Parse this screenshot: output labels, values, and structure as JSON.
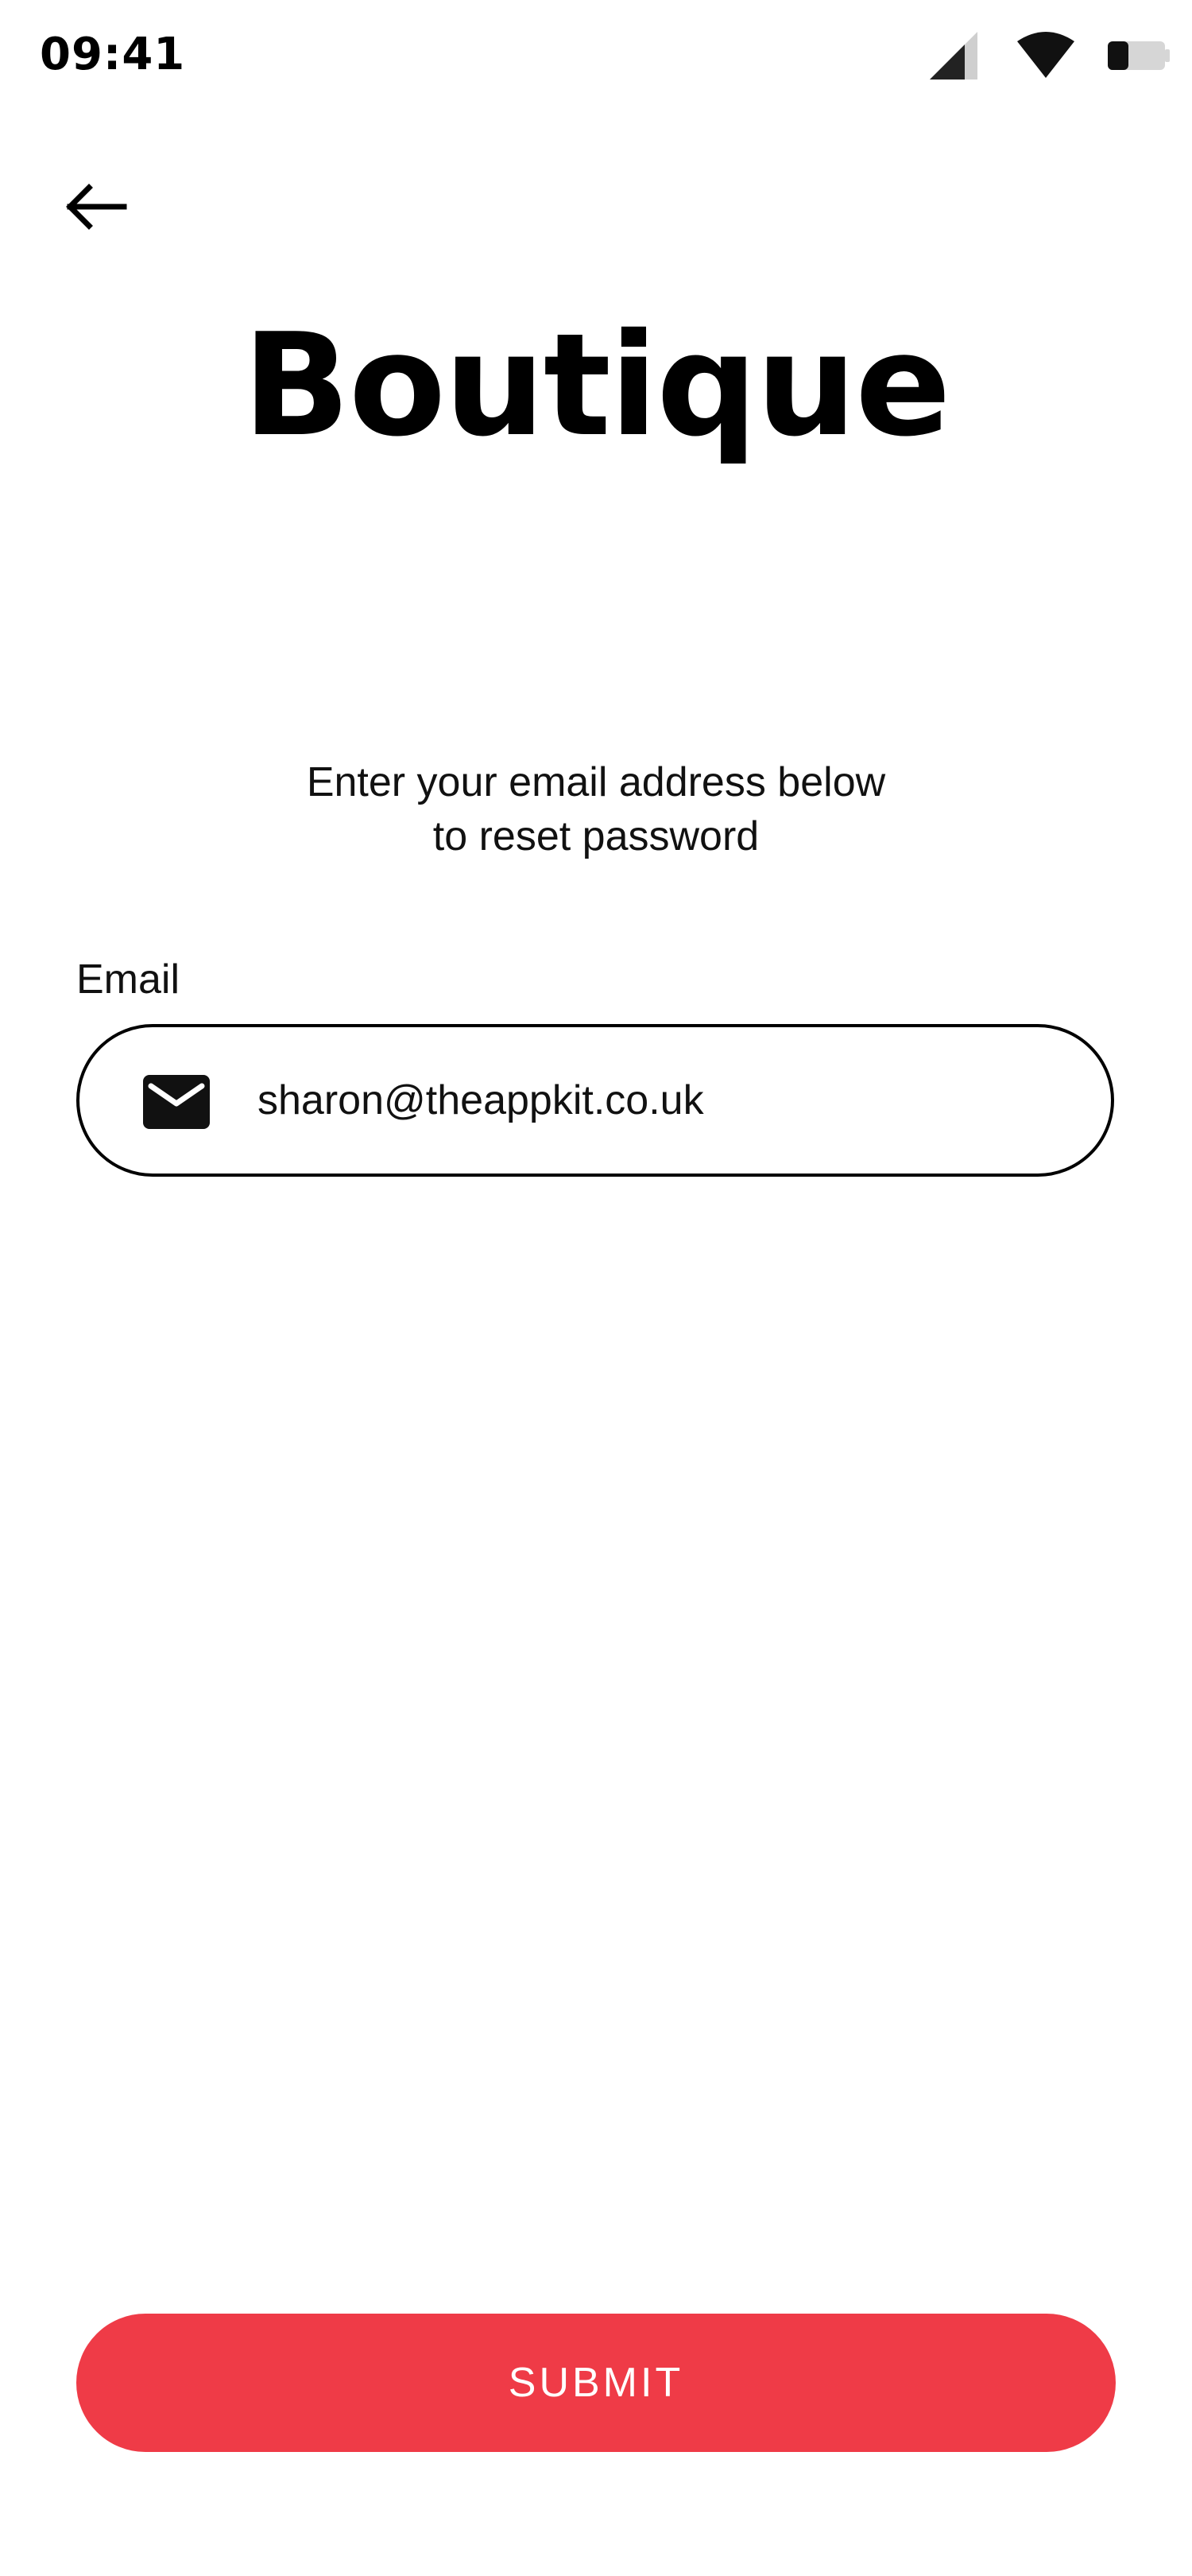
{
  "status_bar": {
    "time": "09:41",
    "icons": [
      "cellular-signal-icon",
      "wifi-icon",
      "battery-icon"
    ]
  },
  "header": {
    "back_icon": "arrow-left-icon",
    "title": "Boutique"
  },
  "form": {
    "instructions_line1": "Enter your email address below",
    "instructions_line2": "to reset password",
    "email_label": "Email",
    "email_icon": "envelope-icon",
    "email_value": "sharon@theappkit.co.uk"
  },
  "actions": {
    "submit_label": "SUBMIT"
  },
  "colors": {
    "accent": "#ef3b47",
    "text": "#000000",
    "background": "#ffffff"
  }
}
